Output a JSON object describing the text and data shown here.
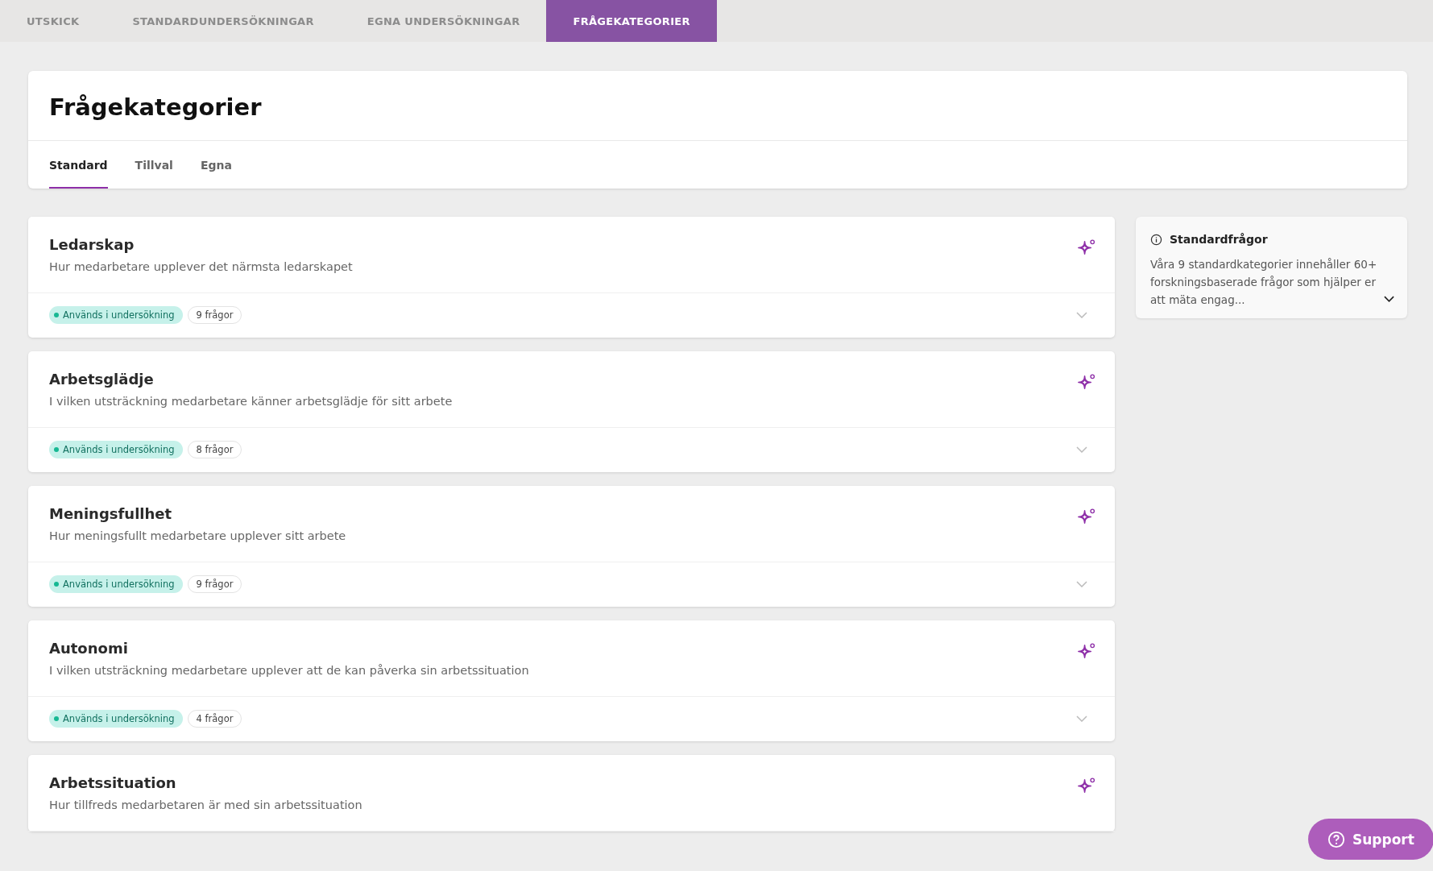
{
  "top_tabs": [
    {
      "label": "UTSKICK",
      "selected": false
    },
    {
      "label": "STANDARDUNDERSÖKNINGAR",
      "selected": false
    },
    {
      "label": "EGNA UNDERSÖKNINGAR",
      "selected": false
    },
    {
      "label": "FRÅGEKATEGORIER",
      "selected": true
    }
  ],
  "header": {
    "title": "Frågekategorier",
    "tabs": [
      {
        "label": "Standard",
        "selected": true
      },
      {
        "label": "Tillval",
        "selected": false
      },
      {
        "label": "Egna",
        "selected": false
      }
    ]
  },
  "categories": [
    {
      "title": "Ledarskap",
      "description": "Hur medarbetare upplever det närmsta ledarskapet",
      "status": {
        "label": "Används i undersökning",
        "active": true
      },
      "count": "9 frågor"
    },
    {
      "title": "Arbetsglädje",
      "description": "I vilken utsträckning medarbetare känner arbetsglädje för sitt arbete",
      "status": {
        "label": "Används i undersökning",
        "active": true
      },
      "count": "8 frågor"
    },
    {
      "title": "Meningsfullhet",
      "description": "Hur meningsfullt medarbetare upplever sitt arbete",
      "status": {
        "label": "Används i undersökning",
        "active": true
      },
      "count": "9 frågor"
    },
    {
      "title": "Autonomi",
      "description": "I vilken utsträckning medarbetare upplever att de kan påverka sin arbetssituation",
      "status": {
        "label": "Används i undersökning",
        "active": true
      },
      "count": "4 frågor"
    },
    {
      "title": "Arbetssituation",
      "description": "Hur tillfreds medarbetaren är med sin arbetssituation"
    }
  ],
  "info_panel": {
    "title": "Standardfrågor",
    "text": "Våra 9 standardkategorier innehåller 60+ forskningsbaserade frågor som hjälper er att mäta engag..."
  },
  "support_button": {
    "label": "Support"
  }
}
